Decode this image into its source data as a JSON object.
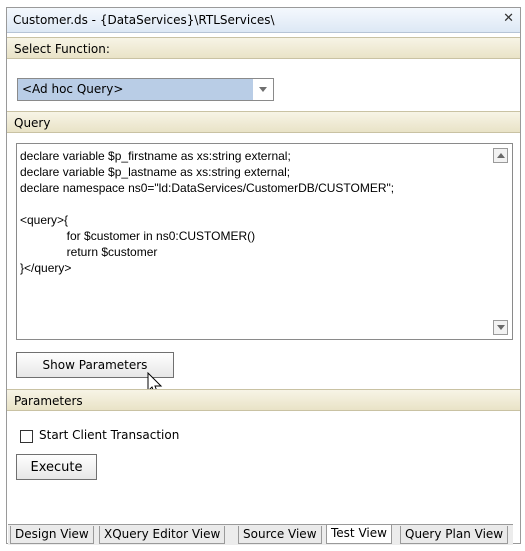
{
  "window": {
    "title": "Customer.ds - {DataServices}\\RTLServices\\",
    "close_glyph": "✕"
  },
  "select_function": {
    "header": "Select Function:",
    "selected": "<Ad hoc Query>"
  },
  "query": {
    "header": "Query",
    "text": "declare variable $p_firstname as xs:string external;\ndeclare variable $p_lastname as xs:string external;\ndeclare namespace ns0=\"ld:DataServices/CustomerDB/CUSTOMER\";\n\n<query>{\n              for $customer in ns0:CUSTOMER()\n              return $customer\n}</query>"
  },
  "buttons": {
    "show_parameters": "Show Parameters",
    "execute": "Execute"
  },
  "parameters": {
    "header": "Parameters",
    "start_client_transaction_label": "Start Client Transaction",
    "start_client_transaction_checked": false
  },
  "tabs": [
    {
      "label": "Design View",
      "active": false
    },
    {
      "label": "XQuery Editor View",
      "active": false
    },
    {
      "label": "Source View",
      "active": false
    },
    {
      "label": "Test View",
      "active": true
    },
    {
      "label": "Query Plan View",
      "active": false
    }
  ]
}
